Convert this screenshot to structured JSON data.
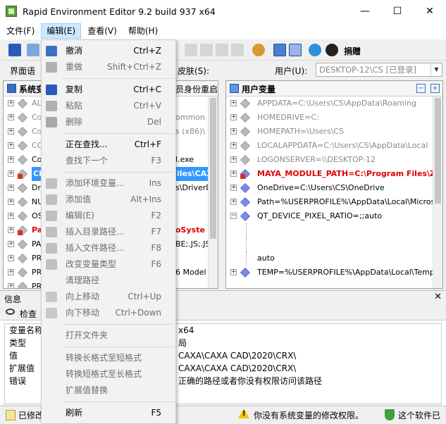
{
  "window": {
    "title": "Rapid Environment Editor 9.2 build 937 x64",
    "controls": {
      "minimize": "—",
      "maximize": "☐",
      "close": "✕"
    }
  },
  "menubar": {
    "items": [
      "文件(F)",
      "编辑(E)",
      "查看(V)",
      "帮助(H)"
    ]
  },
  "toolbar": {
    "donate_label": "捐赠"
  },
  "row2": {
    "interface_label": "界面语",
    "skin_label": "皮肤(S):",
    "user_label": "用户(U):",
    "user_value": "DESKTOP-12\\CS [已登录]"
  },
  "left_panel": {
    "title": "系统变",
    "title_suffix": "员身份重启",
    "rows": [
      {
        "text": "AL",
        "style": "gray"
      },
      {
        "text": "Co",
        "style": "gray",
        "tail": "ommon File"
      },
      {
        "text": "Co",
        "style": "gray",
        "tail": "s (x86)\\"
      },
      {
        "text": "CO",
        "style": "gray"
      },
      {
        "text": "Co",
        "style": "normal",
        "tail": "l.exe"
      },
      {
        "text": "CL",
        "style": "sel",
        "tail": "iles\\CAX"
      },
      {
        "text": "Dr",
        "style": "normal",
        "tail": "s\\DriverDa"
      },
      {
        "text": "NU",
        "style": "normal"
      },
      {
        "text": "OS",
        "style": "normal"
      },
      {
        "text": "Pa",
        "style": "red",
        "tail": "oSyste"
      },
      {
        "text": "PA",
        "style": "normal",
        "tail": "BE;.JS;.JS"
      },
      {
        "text": "PR",
        "style": "normal"
      },
      {
        "text": "PR",
        "style": "normal",
        "tail": "6 Model 1"
      },
      {
        "text": "PR",
        "style": "normal"
      }
    ]
  },
  "right_panel": {
    "title": "用户变量",
    "rows": [
      {
        "text": "APPDATA=C:\\Users\\CS\\AppData\\Roaming",
        "style": "gray"
      },
      {
        "text": "HOMEDRIVE=C:",
        "style": "gray"
      },
      {
        "text": "HOMEPATH=\\Users\\CS",
        "style": "gray"
      },
      {
        "text": "LOCALAPPDATA=C:\\Users\\CS\\AppData\\Local",
        "style": "gray"
      },
      {
        "text": "LOGONSERVER=\\\\DESKTOP-12",
        "style": "gray"
      },
      {
        "text": "MAYA_MODULE_PATH=C:\\Program Files\\Ziv",
        "style": "red"
      },
      {
        "text": "OneDrive=C:\\Users\\CS\\OneDrive",
        "style": "normal"
      },
      {
        "text": "Path=%USERPROFILE%\\AppData\\Local\\Microsoft\\W",
        "style": "normal"
      },
      {
        "text": "QT_DEVICE_PIXEL_RATIO=;;auto",
        "style": "normal"
      },
      {
        "text": "",
        "style": "child"
      },
      {
        "text": "",
        "style": "child"
      },
      {
        "text": "auto",
        "style": "child"
      },
      {
        "text": "TEMP=%USERPROFILE%\\AppData\\Local\\Temp",
        "style": "normal"
      }
    ]
  },
  "info": {
    "title": "信息",
    "close": "✕",
    "tab": "检查",
    "rows": [
      {
        "k": "变量名称",
        "v": "x64"
      },
      {
        "k": "类型",
        "v": "局"
      },
      {
        "k": "值",
        "v": "CAXA\\CAXA CAD\\2020\\CRX\\"
      },
      {
        "k": "扩展值",
        "v": "CAXA\\CAXA CAD\\2020\\CRX\\"
      },
      {
        "k": "错误",
        "v": "正确的路径或者你没有权限访问该路径"
      }
    ]
  },
  "status": {
    "modified": "已修改",
    "warning": "你没有系统变量的修改权限。",
    "right": "这个软件已经"
  },
  "edit_menu": {
    "items": [
      {
        "label": "撤消",
        "shortcut": "Ctrl+Z",
        "enabled": true
      },
      {
        "label": "重做",
        "shortcut": "Shift+Ctrl+Z",
        "enabled": false
      },
      {
        "sep": true
      },
      {
        "label": "复制",
        "shortcut": "Ctrl+C",
        "enabled": true
      },
      {
        "label": "粘贴",
        "shortcut": "Ctrl+V",
        "enabled": false
      },
      {
        "label": "删除",
        "shortcut": "Del",
        "enabled": false
      },
      {
        "sep": true
      },
      {
        "label": "正在查找...",
        "shortcut": "Ctrl+F",
        "enabled": true
      },
      {
        "label": "查找下一个",
        "shortcut": "F3",
        "enabled": false
      },
      {
        "sep": true
      },
      {
        "label": "添加环境变量...",
        "shortcut": "Ins",
        "enabled": false
      },
      {
        "label": "添加值",
        "shortcut": "Alt+Ins",
        "enabled": false
      },
      {
        "label": "编辑(E)",
        "shortcut": "F2",
        "enabled": false
      },
      {
        "label": "插入目录路径...",
        "shortcut": "F7",
        "enabled": false
      },
      {
        "label": "插入文件路径...",
        "shortcut": "F8",
        "enabled": false
      },
      {
        "label": "改变变量类型",
        "shortcut": "F6",
        "enabled": false
      },
      {
        "label": "清理路径",
        "shortcut": "",
        "enabled": false
      },
      {
        "label": "向上移动",
        "shortcut": "Ctrl+Up",
        "enabled": false
      },
      {
        "label": "向下移动",
        "shortcut": "Ctrl+Down",
        "enabled": false
      },
      {
        "sep": true
      },
      {
        "label": "打开文件夹",
        "shortcut": "",
        "enabled": false
      },
      {
        "sep": true
      },
      {
        "label": "转换长格式至短格式",
        "shortcut": "",
        "enabled": false
      },
      {
        "label": "转换短格式至长格式",
        "shortcut": "",
        "enabled": false
      },
      {
        "label": "扩展值替换",
        "shortcut": "",
        "enabled": false
      },
      {
        "sep": true
      },
      {
        "label": "刷新",
        "shortcut": "F5",
        "enabled": true
      }
    ]
  }
}
